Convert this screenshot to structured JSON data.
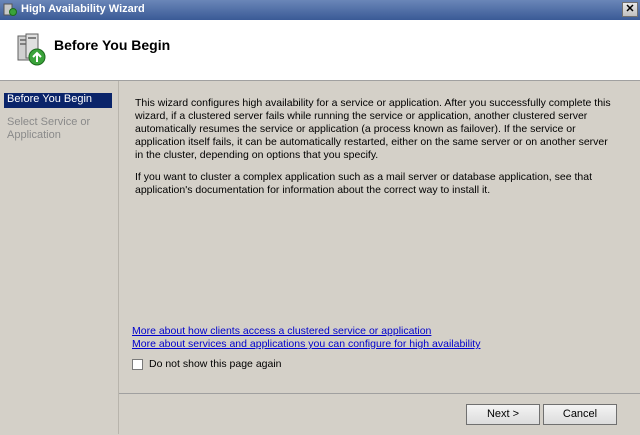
{
  "window": {
    "title": "High Availability Wizard",
    "close_label": "✕"
  },
  "header": {
    "title": "Before You Begin",
    "icon": "cluster-wizard-icon"
  },
  "sidebar": {
    "items": [
      {
        "label": "Before You Begin",
        "state": "active"
      },
      {
        "label": "Select Service or Application",
        "state": "inactive"
      }
    ]
  },
  "content": {
    "paragraph1": "This wizard configures high availability for a service or application. After you successfully complete this wizard, if a clustered server fails while running the service or application, another clustered server automatically resumes the service or application (a process known as failover). If the service or application itself fails, it can be automatically restarted, either on the same server or on another server in the cluster, depending on options that you specify.",
    "paragraph2": "If you want to cluster a complex application such as a mail server or database application, see that application's documentation for information about the correct way to install it.",
    "links": [
      "More about how clients access a clustered service or application",
      "More about services and applications you can configure for high availability"
    ],
    "checkbox": {
      "label": "Do not show this page again",
      "checked": false
    }
  },
  "buttons": {
    "next": "Next >",
    "cancel": "Cancel"
  },
  "colors": {
    "titlebar": "#3a5a96",
    "selection": "#0a246a",
    "link": "#0000cc",
    "background": "#d4d0c8"
  }
}
